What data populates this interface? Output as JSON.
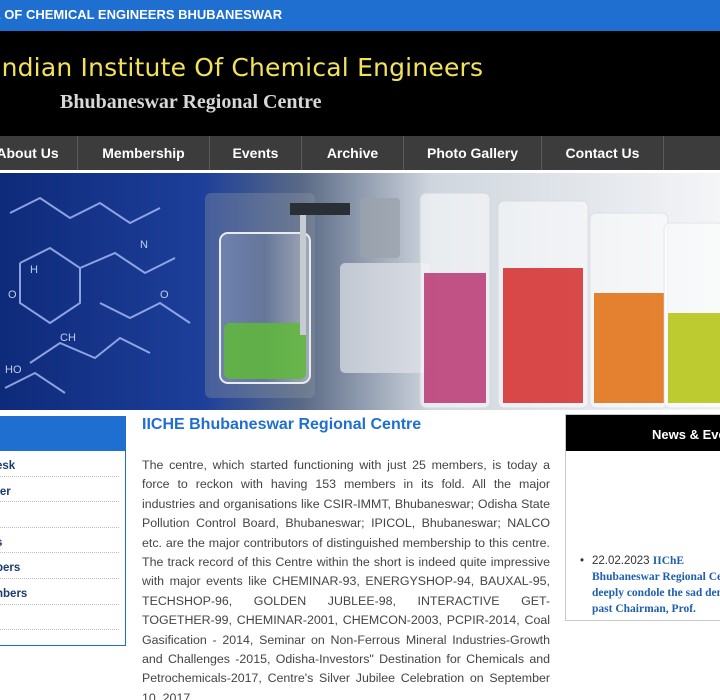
{
  "topbar": {
    "text": "E OF CHEMICAL ENGINEERS BHUBANESWAR"
  },
  "header": {
    "title": "Indian Institute Of Chemical Engineers",
    "subtitle": "Bhubaneswar Regional Centre"
  },
  "nav": {
    "items": [
      {
        "label": "About Us"
      },
      {
        "label": "Membership"
      },
      {
        "label": "Events"
      },
      {
        "label": "Archive"
      },
      {
        "label": "Photo Gallery"
      },
      {
        "label": "Contact Us"
      }
    ]
  },
  "sidebar": {
    "items": [
      {
        "label": "esk"
      },
      {
        "label": "ter"
      },
      {
        "label": ""
      },
      {
        "label": "s"
      },
      {
        "label": "bers"
      },
      {
        "label": "nbers"
      },
      {
        "label": ""
      }
    ]
  },
  "main": {
    "heading": "IICHE Bhubaneswar Regional Centre",
    "body": "The centre, which started functioning with just 25 members, is today a force to reckon with having 153 members in its fold. All the major industries and organisations like CSIR-IMMT, Bhubaneswar; Odisha State Pollution Control Board, Bhubaneswar; IPICOL, Bhubaneswar; NALCO etc. are the major contributors of distinguished membership to this centre. The track record of this Centre within the short is indeed quite impressive with major events like CHEMINAR-93, ENERGYSHOP-94, BAUXAL-95, TECHSHOP-96, GOLDEN JUBLEE-98, INTERACTIVE GET-TOGETHER-99, CHEMINAR-2001, CHEMCON-2003, PCPIR-2014, Coal Gasification - 2014, Seminar on Non-Ferrous Mineral Industries-Growth and Challenges -2015, Odisha-Investors\" Destination for Chemicals and Petrochemicals-2017, Centre's Silver Jubilee Celebration on September 10, 2017,"
  },
  "news": {
    "heading": "News & Events",
    "items": [
      {
        "date": "22.02.2023",
        "text": "IIChE Bhubaneswar Regional Centre deeply condole the sad demise of past Chairman, Prof."
      }
    ]
  }
}
